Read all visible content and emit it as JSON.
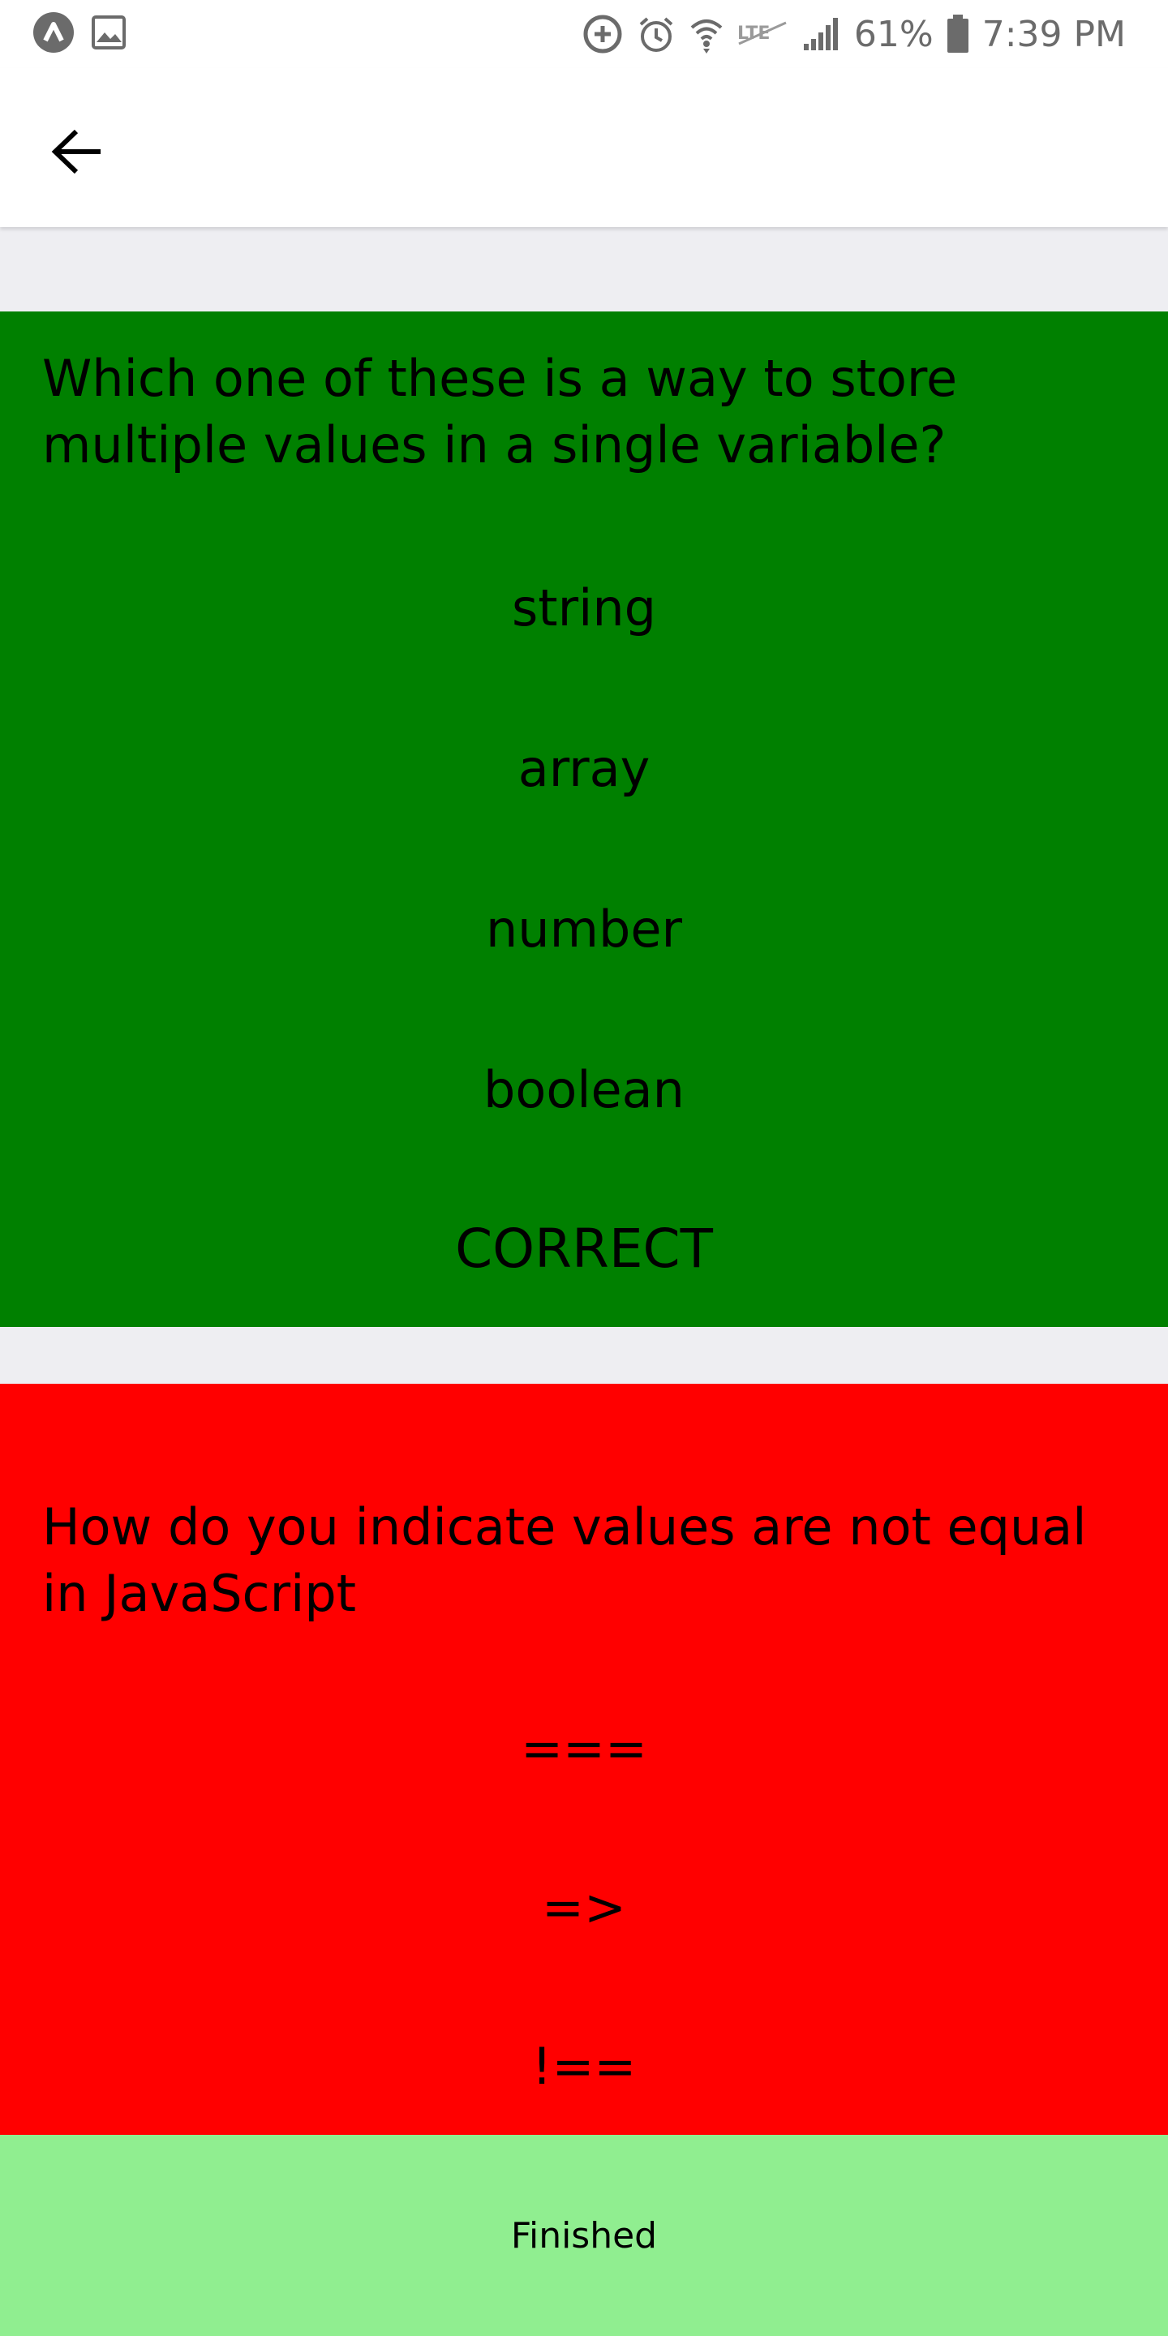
{
  "status_bar": {
    "battery_percent": "61%",
    "time": "7:39 PM",
    "icons": [
      "app-icon",
      "image-icon",
      "data-saver-icon",
      "alarm-icon",
      "wifi-icon",
      "lte-icon",
      "signal-icon",
      "battery-icon"
    ]
  },
  "app_bar": {
    "back_icon": "arrow-left-icon"
  },
  "questions": [
    {
      "text": "Which one of these is a way to store multiple values in a single variable?",
      "answers": [
        "string",
        "array",
        "number",
        "boolean"
      ],
      "result": "CORRECT",
      "color": "#008000"
    },
    {
      "text": "How do you indicate values are not equal in JavaScript",
      "answers": [
        "===",
        "=>",
        "!=="
      ],
      "color": "#ff0000"
    }
  ],
  "finished_button": {
    "label": "Finished",
    "color": "#90ee90"
  }
}
